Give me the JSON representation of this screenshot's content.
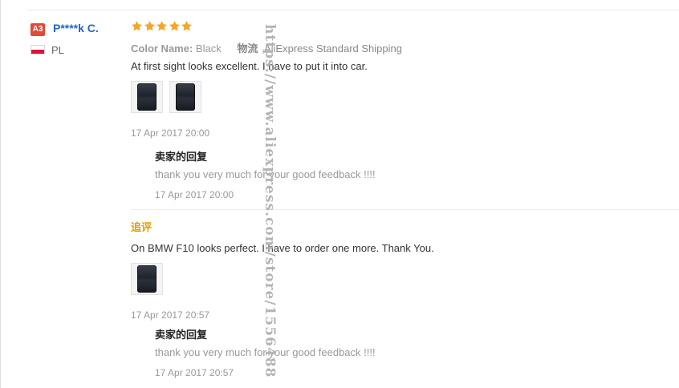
{
  "user": {
    "level_badge": "A3",
    "name": "P****k C.",
    "country": "PL"
  },
  "rating": {
    "stars": 5,
    "max": 5,
    "color": "#f5a623"
  },
  "review": {
    "color_label": "Color Name:",
    "color_value": "Black",
    "shipping_label": "物流",
    "shipping_value": "AliExpress Standard Shipping",
    "text": "At first sight looks excellent. I have to put it into car.",
    "image_count": 2,
    "date": "17 Apr 2017 20:00"
  },
  "seller_reply_1": {
    "title": "卖家的回复",
    "text": "thank you very much for your good feedback !!!!",
    "date": "17 Apr 2017 20:00"
  },
  "additional_review": {
    "label": "追评",
    "text": "On BMW F10 looks perfect. I have to order one more. Thank You.",
    "image_count": 1,
    "date": "17 Apr 2017 20:57"
  },
  "seller_reply_2": {
    "title": "卖家的回复",
    "text": "thank you very much for your good feedback !!!!",
    "date": "17 Apr 2017 20:57"
  },
  "watermark": "https://www.aliexpress.com/store/1556488"
}
